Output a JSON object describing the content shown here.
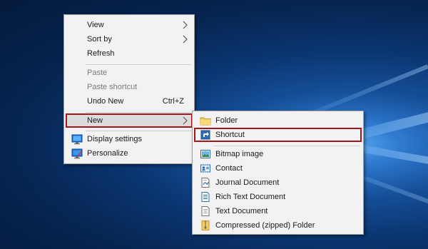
{
  "context_menu": {
    "items": [
      {
        "label": "View",
        "has_submenu": true
      },
      {
        "label": "Sort by",
        "has_submenu": true
      },
      {
        "label": "Refresh"
      },
      {
        "label": "Paste",
        "disabled": true
      },
      {
        "label": "Paste shortcut",
        "disabled": true
      },
      {
        "label": "Undo New",
        "shortcut": "Ctrl+Z"
      },
      {
        "label": "New",
        "has_submenu": true,
        "selected": true
      },
      {
        "label": "Display settings",
        "icon": "display-settings-icon"
      },
      {
        "label": "Personalize",
        "icon": "personalize-icon"
      }
    ]
  },
  "new_submenu": {
    "items": [
      {
        "label": "Folder",
        "icon": "folder-icon"
      },
      {
        "label": "Shortcut",
        "icon": "shortcut-icon",
        "highlighted": true
      },
      {
        "label": "Bitmap image",
        "icon": "bitmap-image-icon"
      },
      {
        "label": "Contact",
        "icon": "contact-icon"
      },
      {
        "label": "Journal Document",
        "icon": "journal-document-icon"
      },
      {
        "label": "Rich Text Document",
        "icon": "rich-text-document-icon"
      },
      {
        "label": "Text Document",
        "icon": "text-document-icon"
      },
      {
        "label": "Compressed (zipped) Folder",
        "icon": "zip-folder-icon"
      }
    ]
  },
  "colors": {
    "menu_background": "#f2f2f2",
    "highlight_border": "#a4161a",
    "desktop_blue": "#0b3672"
  }
}
